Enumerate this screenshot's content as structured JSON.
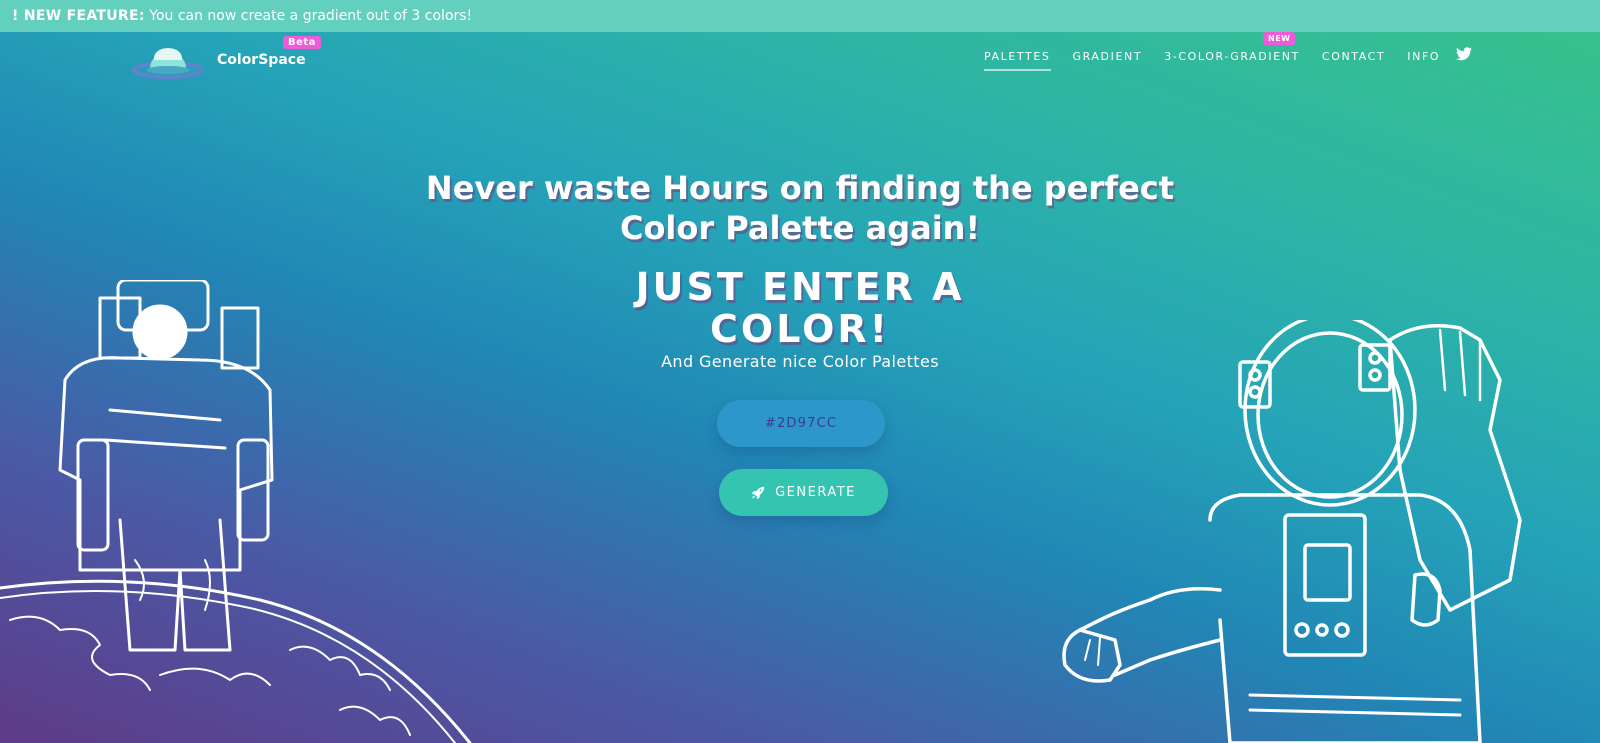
{
  "banner": {
    "prefix": "! NEW FEATURE:",
    "message": "You can now create a gradient out of 3 colors!"
  },
  "brand": {
    "name": "ColorSpace",
    "badge": "Beta",
    "logo_icon": "planet-icon"
  },
  "nav": {
    "items": [
      {
        "label": "PALETTES",
        "active": true
      },
      {
        "label": "GRADIENT",
        "active": false
      },
      {
        "label": "3-COLOR-GRADIENT",
        "active": false,
        "badge": "NEW"
      },
      {
        "label": "CONTACT",
        "active": false
      },
      {
        "label": "INFO",
        "active": false
      }
    ],
    "social_icon": "twitter-icon"
  },
  "hero": {
    "headline_line1": "Never waste Hours on finding the perfect",
    "headline_line2": "Color Palette again!",
    "subhead_line1": "JUST ENTER A",
    "subhead_line2": "COLOR!",
    "tagline": "And Generate nice Color Palettes",
    "color_input_value": "#2D97CC",
    "generate_label": "GENERATE",
    "generate_icon": "rocket-icon"
  },
  "illustrations": {
    "left": "astronaut-on-planet-illustration",
    "right": "astronaut-waving-illustration"
  },
  "colors": {
    "banner_bg": "#63cfbd",
    "badge_pink": "#f05ad9",
    "input_bg": "#2d97cc",
    "button_bg": "#35c4b0",
    "gradient_purple": "#5e3b88",
    "gradient_blue": "#2186b5",
    "gradient_green": "#38c38a"
  }
}
